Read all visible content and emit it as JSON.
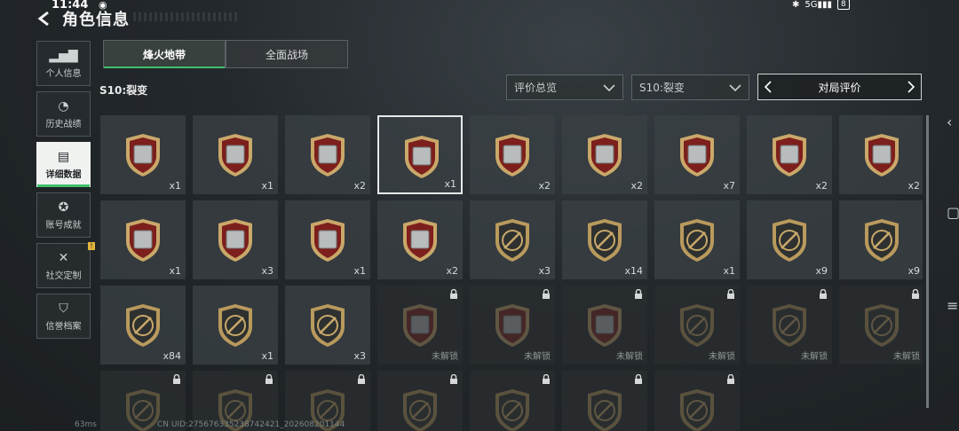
{
  "status_bar": {
    "time": "11:44",
    "icons": [
      "bluetooth-icon",
      "signal-5g-icon",
      "battery-icon"
    ],
    "network": "5G",
    "battery": "8"
  },
  "header": {
    "title": "角色信息"
  },
  "sidebar": {
    "items": [
      {
        "label": "个人信息",
        "icon": "bar-chart-icon",
        "glyph": "▮▮"
      },
      {
        "label": "历史战绩",
        "icon": "clock-icon",
        "glyph": "◔"
      },
      {
        "label": "详细数据",
        "icon": "folder-icon",
        "glyph": "▤",
        "active": true
      },
      {
        "label": "账号成就",
        "icon": "medal-icon",
        "glyph": "✪"
      },
      {
        "label": "社交定制",
        "icon": "tools-icon",
        "glyph": "✕",
        "badge": "!"
      },
      {
        "label": "信誉档案",
        "icon": "shield-icon",
        "glyph": "⛉"
      }
    ]
  },
  "tabs": [
    {
      "label": "烽火地带",
      "active": true
    },
    {
      "label": "全面战场",
      "active": false
    }
  ],
  "season_label": "S10:裂变",
  "filters": {
    "category": {
      "value": "评价总览"
    },
    "season": {
      "value": "S10:裂变"
    },
    "evaluation": {
      "label": "对局评价"
    }
  },
  "rows": [
    [
      {
        "item": "diamond",
        "count": "x1"
      },
      {
        "item": "pearl-orb",
        "count": "x1"
      },
      {
        "item": "golden-tank",
        "count": "x2"
      },
      {
        "item": "computer",
        "count": "x1",
        "selected": true
      },
      {
        "item": "circuit-board",
        "count": "x2"
      },
      {
        "item": "metal-plate",
        "count": "x2"
      },
      {
        "item": "device-tablet",
        "count": "x7"
      },
      {
        "item": "server-unit",
        "count": "x2"
      },
      {
        "item": "lantern",
        "count": "x2"
      }
    ],
    [
      {
        "item": "mechanical-box",
        "count": "x1"
      },
      {
        "item": "golden-frame",
        "count": "x3"
      },
      {
        "item": "glass-jar",
        "count": "x1"
      },
      {
        "item": "reactor-core",
        "count": "x2"
      },
      {
        "item": "crosshair-rifle",
        "count": "x3",
        "emblem": true
      },
      {
        "item": "crosshair-rifle-2",
        "count": "x14",
        "emblem": true
      },
      {
        "item": "crosshair-pistol",
        "count": "x1",
        "emblem": true
      },
      {
        "item": "crosshair-knife",
        "count": "x9",
        "emblem": true
      },
      {
        "item": "explosion",
        "count": "x9",
        "emblem": true
      }
    ],
    [
      {
        "item": "wreath-emblem",
        "count": "x84",
        "emblem": true
      },
      {
        "item": "rank-emblem",
        "count": "x1",
        "emblem": true
      },
      {
        "item": "soldier-emblem",
        "count": "x3",
        "emblem": true
      },
      {
        "item": "crate",
        "locked": true,
        "status": "未解锁"
      },
      {
        "item": "chest",
        "locked": true,
        "status": "未解锁"
      },
      {
        "item": "board",
        "locked": true,
        "status": "未解锁"
      },
      {
        "item": "crosshair",
        "locked": true,
        "status": "未解锁",
        "emblem": true
      },
      {
        "item": "crosshair-rifle",
        "locked": true,
        "status": "未解锁",
        "emblem": true
      },
      {
        "item": "crosshair-rifle-2",
        "locked": true,
        "status": "未解锁",
        "emblem": true
      }
    ],
    [
      {
        "item": "emblem-a",
        "locked": true,
        "emblem": true
      },
      {
        "item": "emblem-b",
        "locked": true,
        "emblem": true
      },
      {
        "item": "emblem-c",
        "locked": true,
        "emblem": true
      },
      {
        "item": "emblem-d",
        "locked": true,
        "emblem": true
      },
      {
        "item": "emblem-e",
        "locked": true,
        "emblem": true
      },
      {
        "item": "emblem-f",
        "locked": true,
        "emblem": true
      },
      {
        "item": "emblem-g",
        "locked": true,
        "emblem": true
      }
    ]
  ],
  "footer": {
    "ping": "63ms",
    "uid": "CN UID:275676335238742421_202608201144"
  },
  "colors": {
    "accent_green": "#3fbf6a",
    "badge_red": "#7d1f1c",
    "badge_gold": "#b99a5d",
    "badge_dark": "#2e3130"
  }
}
